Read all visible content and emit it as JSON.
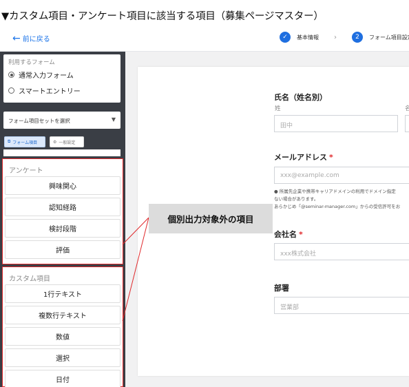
{
  "page_title": "▼カスタム項目・アンケート項目に該当する項目（募集ページマスター）",
  "back_link": "前に戻る",
  "steps": [
    {
      "icon": "✓",
      "label": "基本情報"
    },
    {
      "icon": "2",
      "label": "フォーム項目設定"
    }
  ],
  "step_separator": "›",
  "sidebar": {
    "form_caption": "利用するフォーム",
    "form_options": [
      "通常入力フォーム",
      "スマートエントリー"
    ],
    "selected_form": 0,
    "set_select": "フォーム項目セットを選択",
    "tabs": [
      "フォーム項目",
      "一般設定"
    ],
    "survey": {
      "heading": "アンケート",
      "items": [
        "興味関心",
        "認知経路",
        "検討段階",
        "評価"
      ]
    },
    "custom": {
      "heading": "カスタム項目",
      "items": [
        "1行テキスト",
        "複数行テキスト",
        "数値",
        "選択",
        "日付"
      ]
    }
  },
  "callout": "個別出力対象外の項目",
  "form": {
    "name": {
      "label": "氏名（姓名別）",
      "last_caption": "姓",
      "first_caption": "名",
      "last_placeholder": "田中"
    },
    "email": {
      "label": "メールアドレス",
      "required": "*",
      "placeholder": "xxx@example.com",
      "notes": [
        "● 所属先企業や携帯キャリアドメインの利用でドメイン指定",
        "ない場合があります。",
        "あらかじめ「@seminar-manager.com」からの受信許可をお"
      ]
    },
    "company": {
      "label": "会社名",
      "required": "*",
      "placeholder": "xxx株式会社"
    },
    "dept": {
      "label": "部署",
      "placeholder": "営業部"
    }
  },
  "colors": {
    "accent": "#1f6fe0",
    "highlight": "#e0282b",
    "sidebar_bg": "#3a3e45"
  }
}
